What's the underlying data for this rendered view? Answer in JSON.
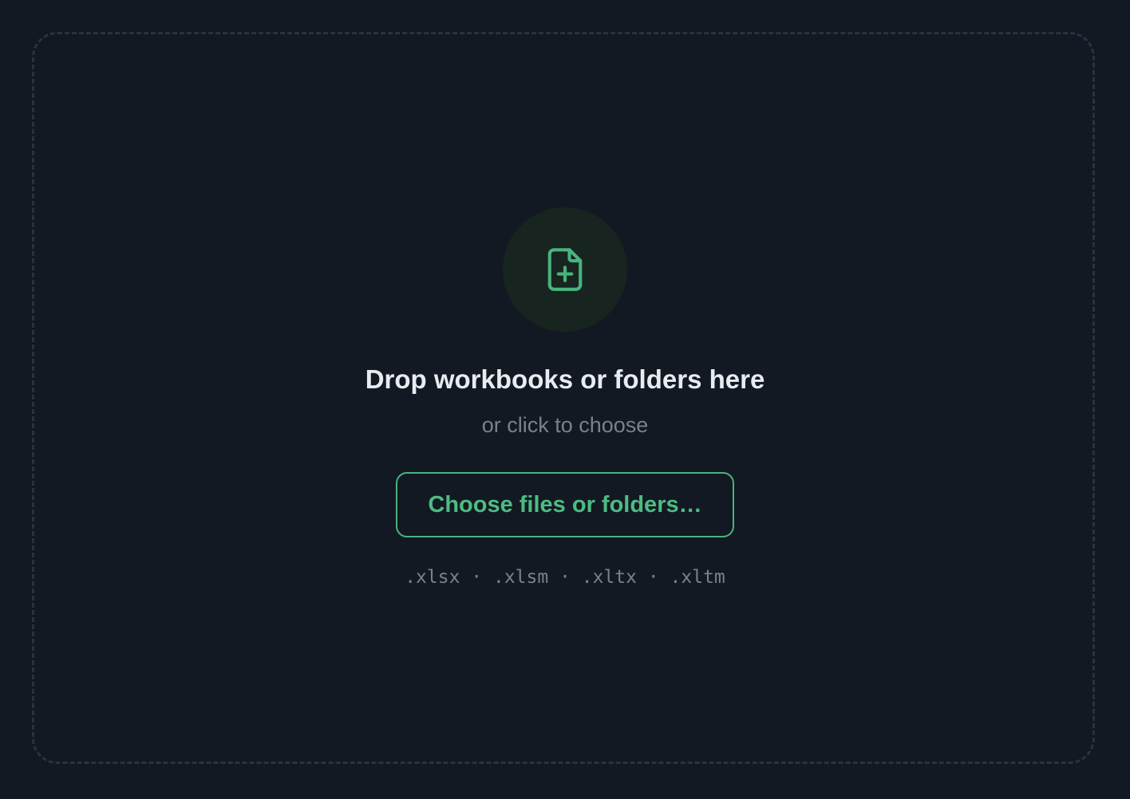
{
  "dropzone": {
    "title": "Drop workbooks or folders here",
    "subtitle": "or click to choose",
    "button_label": "Choose files or folders…",
    "formats_text": ".xlsx · .xlsm · .xltx · .xltm",
    "formats": [
      ".xlsx",
      ".xlsm",
      ".xltx",
      ".xltm"
    ],
    "icon": "file-plus-icon"
  },
  "colors": {
    "background": "#131922",
    "accent": "#47b47e",
    "title": "#e8ebef",
    "muted": "#7a818b"
  }
}
